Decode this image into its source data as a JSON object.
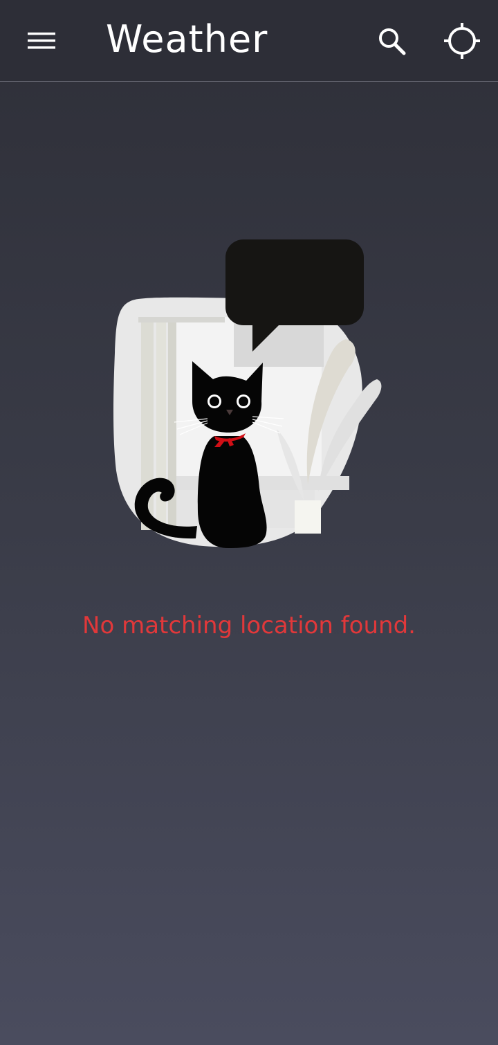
{
  "app_bar": {
    "title": "Weather",
    "menu_icon": "menu-icon",
    "search_icon": "search-icon",
    "location_icon": "my-location-icon"
  },
  "empty_state": {
    "illustration": "black-cat-speech-bubble-illustration",
    "message": "No matching location found."
  },
  "colors": {
    "app_bar_bg": "#2d2e37",
    "background_top": "#2e2f38",
    "background_bottom": "#4a4c5e",
    "error_text": "#e1383a",
    "title_text": "#ffffff"
  }
}
